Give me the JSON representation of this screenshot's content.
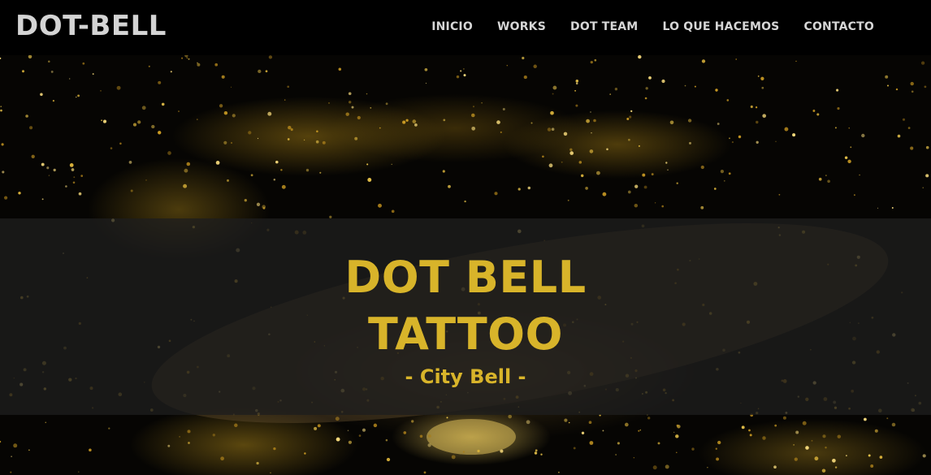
{
  "brand": {
    "name": "DOT-BELL"
  },
  "nav": {
    "items": [
      {
        "label": "INICIO"
      },
      {
        "label": "WORKS"
      },
      {
        "label": "DOT TEAM"
      },
      {
        "label": "LO QUE HACEMOS"
      },
      {
        "label": "CONTACTO"
      }
    ]
  },
  "hero": {
    "title_line1": "DOT BELL",
    "title_line2": "TATTOO",
    "subtitle": "- City Bell -"
  },
  "colors": {
    "accent": "#d8b42a",
    "nav_text": "#d6d6d6",
    "background": "#000000"
  }
}
